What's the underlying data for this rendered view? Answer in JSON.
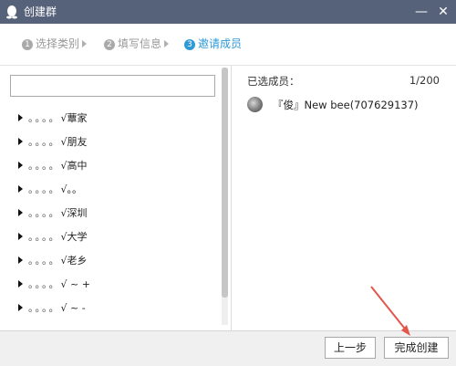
{
  "window": {
    "title": "创建群",
    "minimize": "—",
    "close": "✕",
    "icon": "qq-penguin-icon"
  },
  "steps": [
    {
      "num": "1",
      "label": "选择类别",
      "active": false
    },
    {
      "num": "2",
      "label": "填写信息",
      "active": false
    },
    {
      "num": "3",
      "label": "邀请成员",
      "active": true
    }
  ],
  "search": {
    "value": "",
    "placeholder": ""
  },
  "tree": [
    {
      "prefix": "。。。。",
      "label": "√蕈家"
    },
    {
      "prefix": "。。。。",
      "label": "√朋友"
    },
    {
      "prefix": "。。。。",
      "label": "√高中"
    },
    {
      "prefix": "。。。。",
      "label": "√。。"
    },
    {
      "prefix": "。。。。",
      "label": "√深圳"
    },
    {
      "prefix": "。。。。",
      "label": "√大学"
    },
    {
      "prefix": "。。。。",
      "label": "√老乡"
    },
    {
      "prefix": "。。。。",
      "label": "√ ~ +"
    },
    {
      "prefix": "。。。。",
      "label": "√ ~ -"
    }
  ],
  "selected": {
    "label": "已选成员：",
    "count": "1/200",
    "members": [
      {
        "name": "『俊』New bee(707629137)"
      }
    ]
  },
  "footer": {
    "prev_label": "上一步",
    "create_label": "完成创建"
  },
  "colors": {
    "titlebar": "#56617a",
    "active_step": "#2e9ad6",
    "annotation_arrow": "#e2574c"
  }
}
